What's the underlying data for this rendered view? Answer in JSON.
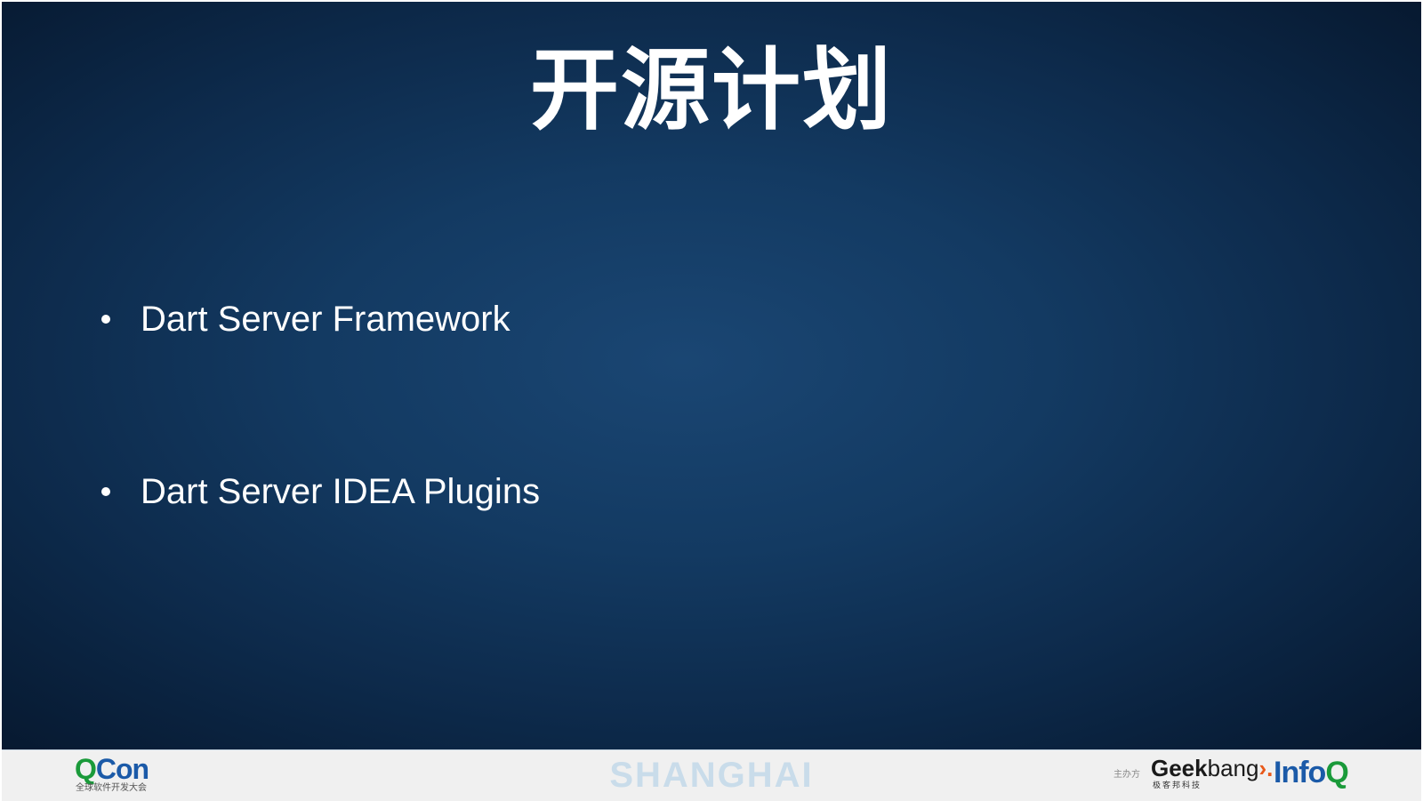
{
  "slide": {
    "title": "开源计划",
    "bullets": [
      {
        "text": "Dart Server Framework"
      },
      {
        "text": "Dart Server IDEA Plugins"
      }
    ]
  },
  "footer": {
    "qcon": {
      "q": "Q",
      "con": "Con",
      "subtitle": "全球软件开发大会"
    },
    "city": "SHANGHAI",
    "host_label": "主办方",
    "geekbang": {
      "geek": "Geek",
      "bang": "bang",
      "chevron": "›.",
      "subtitle": "极客邦科技"
    },
    "infoq": {
      "info": "Info",
      "q": "Q"
    }
  },
  "colors": {
    "background_center": "#1a4673",
    "background_edge": "#06172d",
    "title_text": "#ffffff",
    "footer_bg": "#f0f0f0",
    "qcon_green": "#1a9a3a",
    "qcon_blue": "#1b5aa8",
    "city_text": "#c9dcea",
    "geekbang_orange": "#e8591a"
  }
}
